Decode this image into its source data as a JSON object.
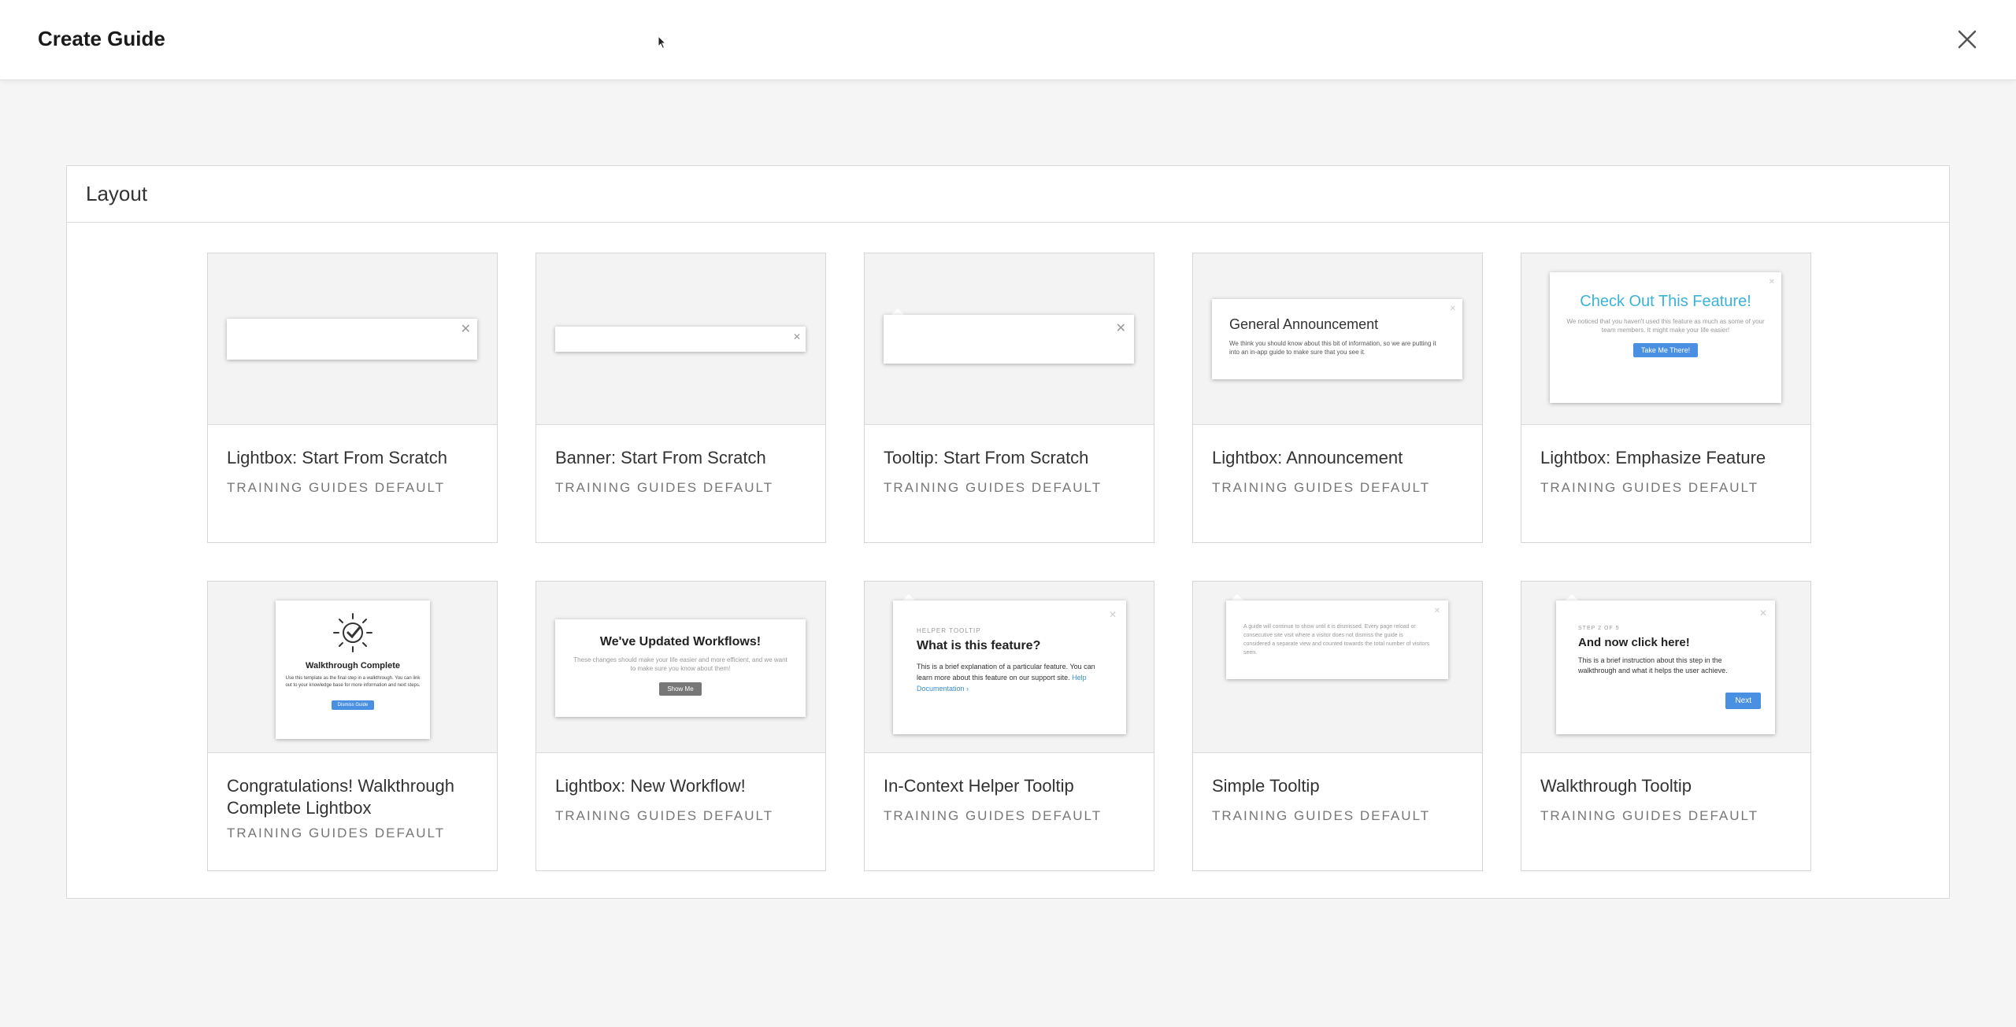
{
  "header": {
    "title": "Create Guide",
    "close_label": "×"
  },
  "panel": {
    "title": "Layout"
  },
  "cards": [
    {
      "title": "Lightbox: Start From Scratch",
      "subtitle": "TRAINING GUIDES DEFAULT"
    },
    {
      "title": "Banner: Start From Scratch",
      "subtitle": "TRAINING GUIDES DEFAULT"
    },
    {
      "title": "Tooltip: Start From Scratch",
      "subtitle": "TRAINING GUIDES DEFAULT"
    },
    {
      "title": "Lightbox: Announcement",
      "subtitle": "TRAINING GUIDES DEFAULT"
    },
    {
      "title": "Lightbox: Emphasize Feature",
      "subtitle": "TRAINING GUIDES DEFAULT"
    },
    {
      "title": "Congratulations! Walkthrough Complete Lightbox",
      "subtitle": "TRAINING GUIDES DEFAULT"
    },
    {
      "title": "Lightbox: New Workflow!",
      "subtitle": "TRAINING GUIDES DEFAULT"
    },
    {
      "title": "In-Context Helper Tooltip",
      "subtitle": "TRAINING GUIDES DEFAULT"
    },
    {
      "title": "Simple Tooltip",
      "subtitle": "TRAINING GUIDES DEFAULT"
    },
    {
      "title": "Walkthrough Tooltip",
      "subtitle": "TRAINING GUIDES DEFAULT"
    }
  ],
  "previews": {
    "announcement": {
      "title": "General Announcement",
      "body": "We think you should know about this bit of information, so we are putting it into an in-app guide to make sure that you see it."
    },
    "emphasize": {
      "title": "Check Out This Feature!",
      "body": "We noticed that you haven't used this feature as much as some of your team members. It might make your life easier!",
      "button": "Take Me There!"
    },
    "complete": {
      "title": "Walkthrough Complete",
      "body": "Use this template as the final step in a walkthrough. You can link out to your knowledge base for more information and next steps.",
      "button": "Dismiss Guide"
    },
    "workflow": {
      "title": "We've Updated Workflows!",
      "body": "These changes should make your life easier and more efficient, and we want to make sure you know about them!",
      "button": "Show Me"
    },
    "helper": {
      "eyebrow": "HELPER TOOLTIP",
      "title": "What is this feature?",
      "body": "This is a brief explanation of a particular feature. You can learn more about this feature on our support site.",
      "link": "Help Documentation ›"
    },
    "simple": {
      "body": "A guide will continue to show until it is dismissed. Every page reload or consecutive site visit where a visitor does not dismiss the guide is considered a separate view and counted towards the total number of visitors seen."
    },
    "walkthrough": {
      "eyebrow": "STEP 2 OF 5",
      "title": "And now click here!",
      "body": "This is a brief instruction about this step in the walkthrough and what it helps the user achieve.",
      "button": "Next"
    }
  },
  "colors": {
    "accent": "#4a90e2",
    "teal": "#3bb3d6"
  }
}
